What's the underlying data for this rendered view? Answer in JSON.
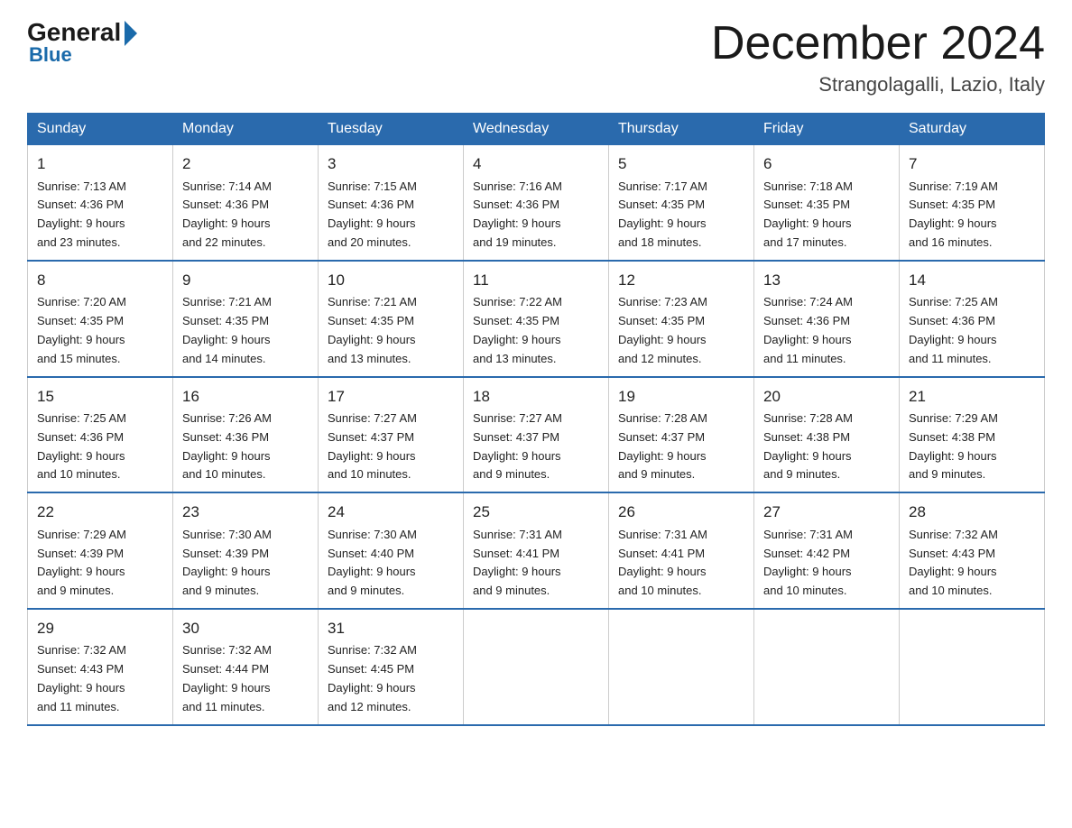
{
  "logo": {
    "general": "General",
    "blue": "Blue"
  },
  "title": "December 2024",
  "subtitle": "Strangolagalli, Lazio, Italy",
  "headers": [
    "Sunday",
    "Monday",
    "Tuesday",
    "Wednesday",
    "Thursday",
    "Friday",
    "Saturday"
  ],
  "weeks": [
    [
      {
        "day": "1",
        "sunrise": "7:13 AM",
        "sunset": "4:36 PM",
        "daylight": "9 hours and 23 minutes."
      },
      {
        "day": "2",
        "sunrise": "7:14 AM",
        "sunset": "4:36 PM",
        "daylight": "9 hours and 22 minutes."
      },
      {
        "day": "3",
        "sunrise": "7:15 AM",
        "sunset": "4:36 PM",
        "daylight": "9 hours and 20 minutes."
      },
      {
        "day": "4",
        "sunrise": "7:16 AM",
        "sunset": "4:36 PM",
        "daylight": "9 hours and 19 minutes."
      },
      {
        "day": "5",
        "sunrise": "7:17 AM",
        "sunset": "4:35 PM",
        "daylight": "9 hours and 18 minutes."
      },
      {
        "day": "6",
        "sunrise": "7:18 AM",
        "sunset": "4:35 PM",
        "daylight": "9 hours and 17 minutes."
      },
      {
        "day": "7",
        "sunrise": "7:19 AM",
        "sunset": "4:35 PM",
        "daylight": "9 hours and 16 minutes."
      }
    ],
    [
      {
        "day": "8",
        "sunrise": "7:20 AM",
        "sunset": "4:35 PM",
        "daylight": "9 hours and 15 minutes."
      },
      {
        "day": "9",
        "sunrise": "7:21 AM",
        "sunset": "4:35 PM",
        "daylight": "9 hours and 14 minutes."
      },
      {
        "day": "10",
        "sunrise": "7:21 AM",
        "sunset": "4:35 PM",
        "daylight": "9 hours and 13 minutes."
      },
      {
        "day": "11",
        "sunrise": "7:22 AM",
        "sunset": "4:35 PM",
        "daylight": "9 hours and 13 minutes."
      },
      {
        "day": "12",
        "sunrise": "7:23 AM",
        "sunset": "4:35 PM",
        "daylight": "9 hours and 12 minutes."
      },
      {
        "day": "13",
        "sunrise": "7:24 AM",
        "sunset": "4:36 PM",
        "daylight": "9 hours and 11 minutes."
      },
      {
        "day": "14",
        "sunrise": "7:25 AM",
        "sunset": "4:36 PM",
        "daylight": "9 hours and 11 minutes."
      }
    ],
    [
      {
        "day": "15",
        "sunrise": "7:25 AM",
        "sunset": "4:36 PM",
        "daylight": "9 hours and 10 minutes."
      },
      {
        "day": "16",
        "sunrise": "7:26 AM",
        "sunset": "4:36 PM",
        "daylight": "9 hours and 10 minutes."
      },
      {
        "day": "17",
        "sunrise": "7:27 AM",
        "sunset": "4:37 PM",
        "daylight": "9 hours and 10 minutes."
      },
      {
        "day": "18",
        "sunrise": "7:27 AM",
        "sunset": "4:37 PM",
        "daylight": "9 hours and 9 minutes."
      },
      {
        "day": "19",
        "sunrise": "7:28 AM",
        "sunset": "4:37 PM",
        "daylight": "9 hours and 9 minutes."
      },
      {
        "day": "20",
        "sunrise": "7:28 AM",
        "sunset": "4:38 PM",
        "daylight": "9 hours and 9 minutes."
      },
      {
        "day": "21",
        "sunrise": "7:29 AM",
        "sunset": "4:38 PM",
        "daylight": "9 hours and 9 minutes."
      }
    ],
    [
      {
        "day": "22",
        "sunrise": "7:29 AM",
        "sunset": "4:39 PM",
        "daylight": "9 hours and 9 minutes."
      },
      {
        "day": "23",
        "sunrise": "7:30 AM",
        "sunset": "4:39 PM",
        "daylight": "9 hours and 9 minutes."
      },
      {
        "day": "24",
        "sunrise": "7:30 AM",
        "sunset": "4:40 PM",
        "daylight": "9 hours and 9 minutes."
      },
      {
        "day": "25",
        "sunrise": "7:31 AM",
        "sunset": "4:41 PM",
        "daylight": "9 hours and 9 minutes."
      },
      {
        "day": "26",
        "sunrise": "7:31 AM",
        "sunset": "4:41 PM",
        "daylight": "9 hours and 10 minutes."
      },
      {
        "day": "27",
        "sunrise": "7:31 AM",
        "sunset": "4:42 PM",
        "daylight": "9 hours and 10 minutes."
      },
      {
        "day": "28",
        "sunrise": "7:32 AM",
        "sunset": "4:43 PM",
        "daylight": "9 hours and 10 minutes."
      }
    ],
    [
      {
        "day": "29",
        "sunrise": "7:32 AM",
        "sunset": "4:43 PM",
        "daylight": "9 hours and 11 minutes."
      },
      {
        "day": "30",
        "sunrise": "7:32 AM",
        "sunset": "4:44 PM",
        "daylight": "9 hours and 11 minutes."
      },
      {
        "day": "31",
        "sunrise": "7:32 AM",
        "sunset": "4:45 PM",
        "daylight": "9 hours and 12 minutes."
      },
      null,
      null,
      null,
      null
    ]
  ],
  "labels": {
    "sunrise": "Sunrise:",
    "sunset": "Sunset:",
    "daylight": "Daylight:"
  }
}
